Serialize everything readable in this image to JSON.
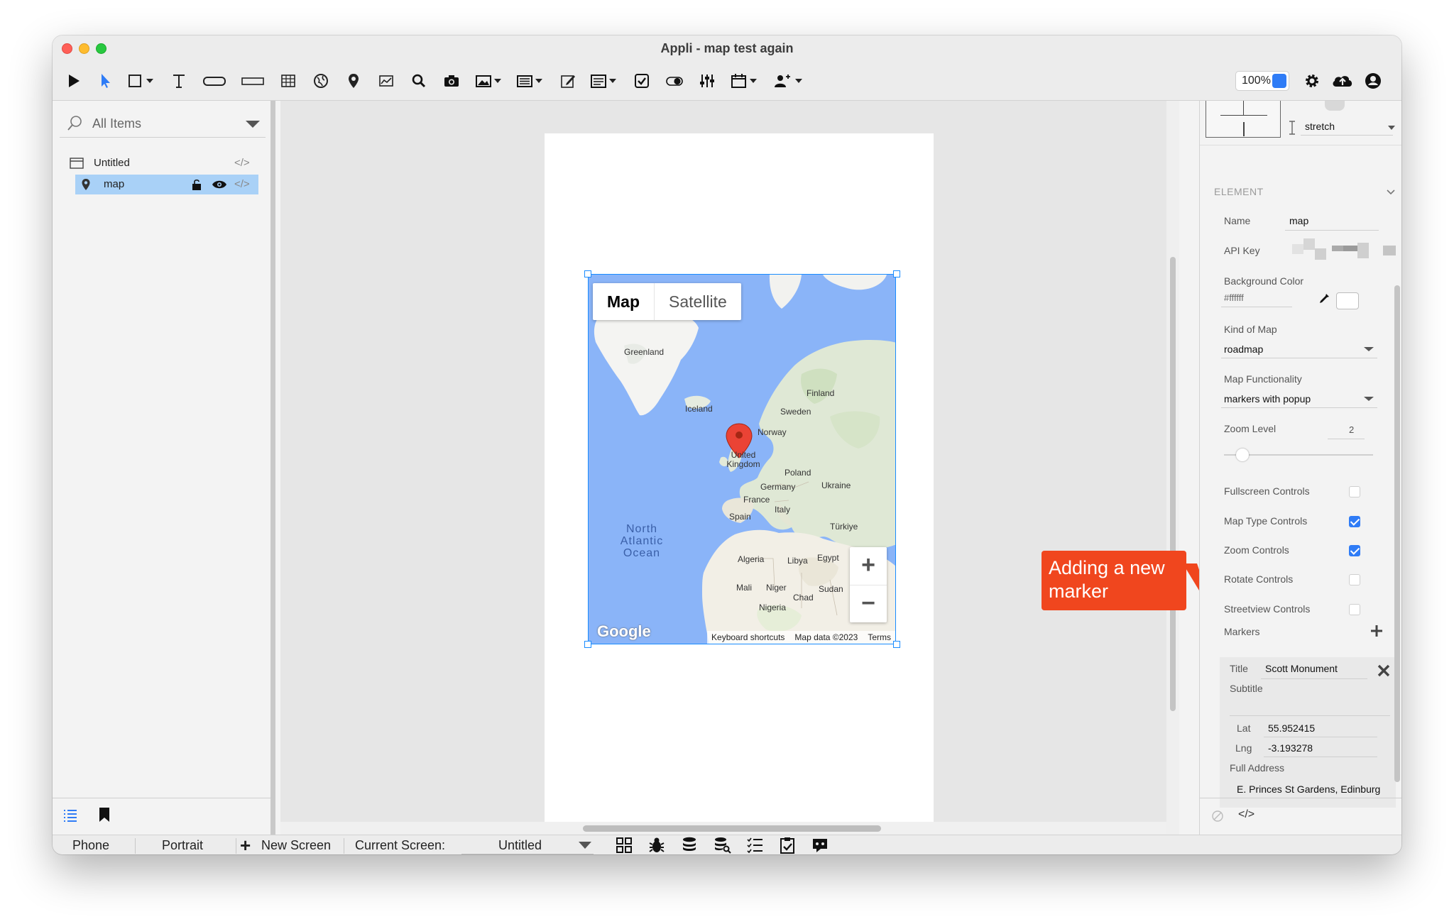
{
  "window": {
    "title": "Appli - map test again"
  },
  "toolbar": {
    "zoom": "100%",
    "tools": [
      "play-icon",
      "pointer-icon",
      "rectangle-icon",
      "text-icon",
      "button-icon",
      "textfield-icon",
      "table-icon",
      "globe-icon",
      "map-pin-icon",
      "chart-icon",
      "search-icon",
      "camera-icon",
      "image-icon",
      "list-icon",
      "edit-icon",
      "form-icon",
      "checkbox-icon",
      "toggle-icon",
      "sliders-icon",
      "calendar-icon",
      "user-add-icon"
    ],
    "right_tools": [
      "gear-icon",
      "cloud-upload-icon",
      "account-icon"
    ]
  },
  "left": {
    "search_placeholder": "All Items",
    "tree": [
      {
        "label": "Untitled",
        "icon": "window-icon"
      },
      {
        "label": "map",
        "icon": "map-pin-icon",
        "selected": true
      }
    ]
  },
  "map": {
    "type_buttons": [
      "Map",
      "Satellite"
    ],
    "labels": {
      "greenland": "Greenland",
      "iceland": "Iceland",
      "finland": "Finland",
      "sweden": "Sweden",
      "norway": "Norway",
      "uk": "United Kingdom",
      "poland": "Poland",
      "germany": "Germany",
      "ukraine": "Ukraine",
      "france": "France",
      "italy": "Italy",
      "spain": "Spain",
      "turkiye": "Türkiye",
      "algeria": "Algeria",
      "libya": "Libya",
      "egypt": "Egypt",
      "mali": "Mali",
      "niger": "Niger",
      "chad": "Chad",
      "sudan": "Sudan",
      "nigeria": "Nigeria",
      "ocean": "North Atlantic Ocean"
    },
    "footer": [
      "Keyboard shortcuts",
      "Map data ©2023",
      "Terms"
    ],
    "google": "Google"
  },
  "callout": "Adding a new marker",
  "properties": {
    "layout_stretch": "stretch",
    "section": "ELEMENT",
    "name_label": "Name",
    "name_value": "map",
    "api_key_label": "API Key",
    "bg_label": "Background Color",
    "bg_value": "#ffffff",
    "kind_label": "Kind of Map",
    "kind_value": "roadmap",
    "func_label": "Map Functionality",
    "func_value": "markers with popup",
    "zoom_label": "Zoom Level",
    "zoom_value": "2",
    "zoom_level_fraction": 0.08,
    "checks": [
      {
        "label": "Fullscreen Controls",
        "checked": false
      },
      {
        "label": "Map Type Controls",
        "checked": true
      },
      {
        "label": "Zoom Controls",
        "checked": true
      },
      {
        "label": "Rotate Controls",
        "checked": false
      },
      {
        "label": "Streetview Controls",
        "checked": false
      }
    ],
    "markers_label": "Markers",
    "marker": {
      "title_label": "Title",
      "title_value": "Scott Monument",
      "subtitle_label": "Subtitle",
      "lat_label": "Lat",
      "lat_value": "55.952415",
      "lng_label": "Lng",
      "lng_value": "-3.193278",
      "address_label": "Full Address",
      "address_value": "E. Princes St Gardens, Edinburg"
    }
  },
  "status": {
    "phone": "Phone",
    "portrait": "Portrait",
    "new_screen": "New Screen",
    "current_screen_label": "Current Screen:",
    "current_screen_value": "Untitled",
    "icons": [
      "grid-icon",
      "bug-icon",
      "database-icon",
      "database-search-icon",
      "checklist-icon",
      "clipboard-check-icon",
      "chat-icon"
    ]
  },
  "colors": {
    "accent": "#2f7cf6",
    "callout": "#f0461e",
    "selection": "#a9d1f7",
    "water": "#8ab4f8"
  }
}
